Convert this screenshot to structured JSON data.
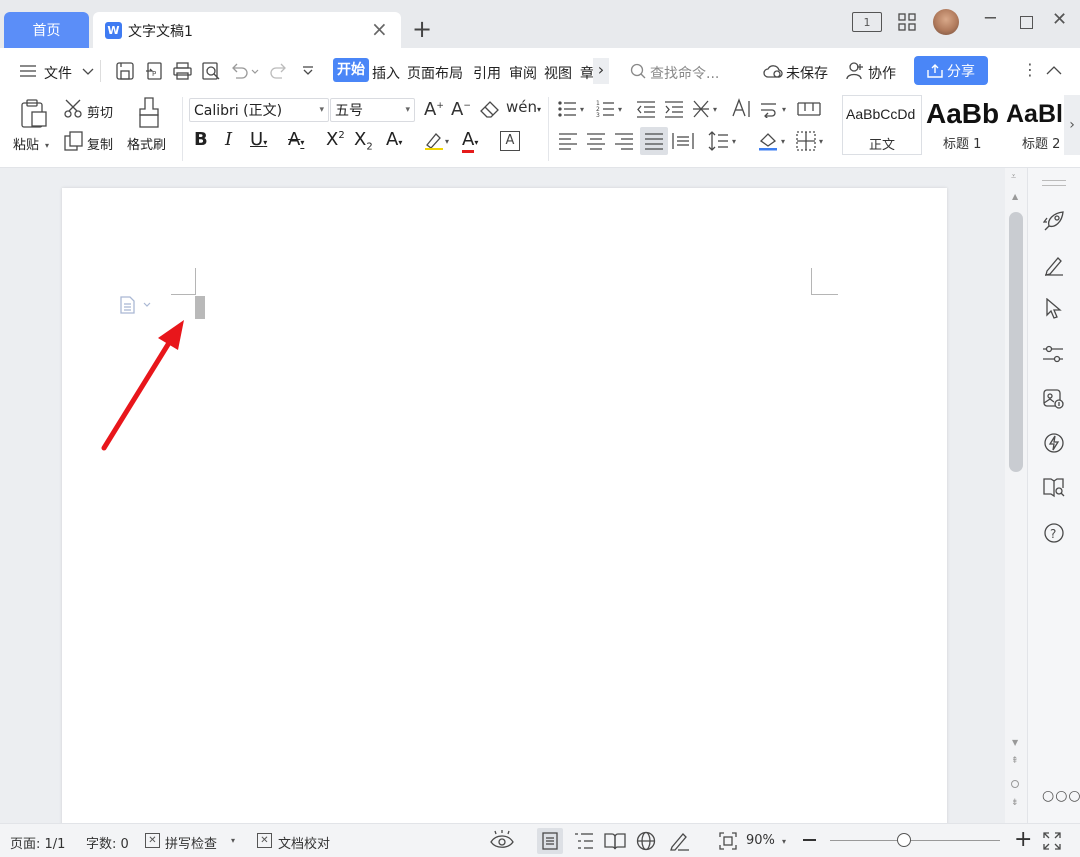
{
  "titlebar": {
    "home_tab": "首页",
    "doc_tab": "文字文稿1",
    "new_tab": "+",
    "close_tab": "×",
    "page_count_badge": "1"
  },
  "menu": {
    "file": "文件",
    "tabs": [
      "开始",
      "插入",
      "页面布局",
      "引用",
      "审阅",
      "视图",
      "章"
    ],
    "more": "›",
    "search_placeholder": "查找命令...",
    "unsaved": "未保存",
    "collab": "协作",
    "share": "分享"
  },
  "ribbon": {
    "paste": "粘贴",
    "cut": "剪切",
    "copy": "复制",
    "format_painter": "格式刷",
    "font_name": "Calibri (正文)",
    "font_size": "五号",
    "styles": [
      {
        "preview": "AaBbCcDd",
        "name": "正文"
      },
      {
        "preview": "AaBb",
        "name": "标题 1"
      },
      {
        "preview": "AaBl",
        "name": "标题 2"
      }
    ]
  },
  "status": {
    "page": "页面: 1/1",
    "words": "字数: 0",
    "spell": "拼写检查",
    "proof": "文档校对",
    "zoom": "90%"
  },
  "colors": {
    "accent": "#4a86f7",
    "home_tab": "#5b8ef8",
    "arrow": "#e8161b"
  }
}
